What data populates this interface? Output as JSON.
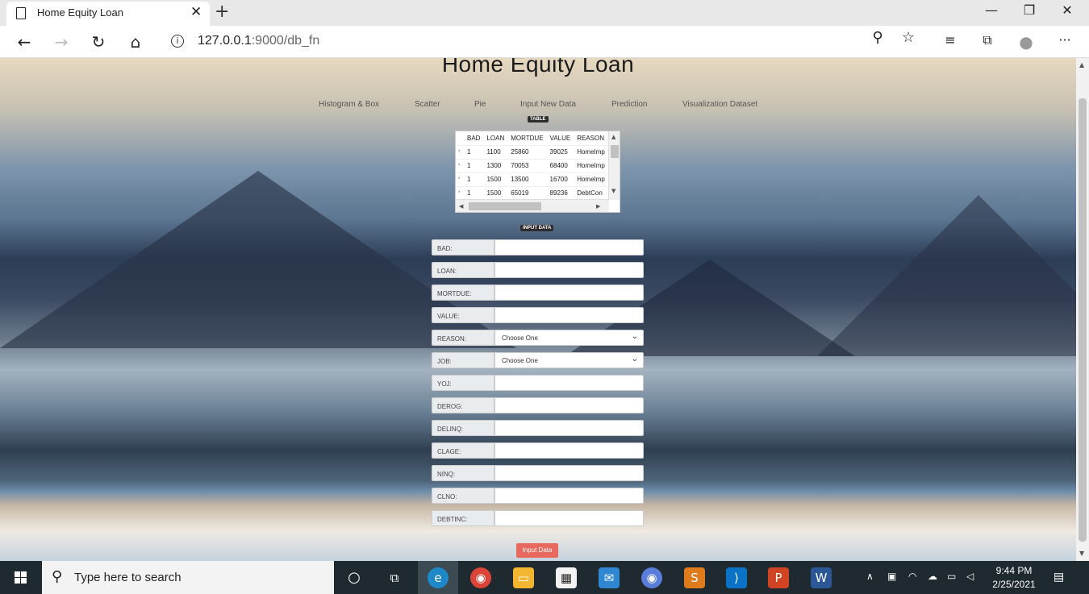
{
  "browser": {
    "tab_title": "Home Equity Loan",
    "tab_close": "✕",
    "new_tab": "+",
    "url_host": "127.0.0.1",
    "url_rest": ":9000/db_fn",
    "win_min": "—",
    "win_max": "❐",
    "win_close": "✕"
  },
  "page": {
    "title": "Home Equity Loan",
    "menu": [
      "Histogram & Box",
      "Scatter",
      "Pie",
      "Input New Data",
      "Prediction",
      "Visualization Dataset"
    ],
    "table_label": "TABLE",
    "input_label": "INPUT DATA",
    "submit_label": "Input Data"
  },
  "table": {
    "columns": [
      "BAD",
      "LOAN",
      "MORTDUE",
      "VALUE",
      "REASON"
    ],
    "rows": [
      [
        "1",
        "1100",
        "25860",
        "39025",
        "HomeImp"
      ],
      [
        "1",
        "1300",
        "70053",
        "68400",
        "HomeImp"
      ],
      [
        "1",
        "1500",
        "13500",
        "16700",
        "HomeImp"
      ],
      [
        "1",
        "1500",
        "65019",
        "89236",
        "DebtCon"
      ]
    ],
    "row_marker": "*"
  },
  "form": {
    "fields": [
      {
        "label": "BAD:",
        "value": ""
      },
      {
        "label": "LOAN:",
        "value": ""
      },
      {
        "label": "MORTDUE:",
        "value": ""
      },
      {
        "label": "VALUE:",
        "value": ""
      },
      {
        "label": "REASON:",
        "value": "Choose One"
      },
      {
        "label": "JOB:",
        "value": "Choose One"
      },
      {
        "label": "YOJ:",
        "value": ""
      },
      {
        "label": "DEROG:",
        "value": ""
      },
      {
        "label": "DELINQ:",
        "value": ""
      },
      {
        "label": "CLAGE:",
        "value": ""
      },
      {
        "label": "NINQ:",
        "value": ""
      },
      {
        "label": "CLNO:",
        "value": ""
      },
      {
        "label": "DEBTINC:",
        "value": ""
      }
    ]
  },
  "taskbar": {
    "search_placeholder": "Type here to search",
    "time": "9:44 PM",
    "date": "2/25/2021"
  }
}
